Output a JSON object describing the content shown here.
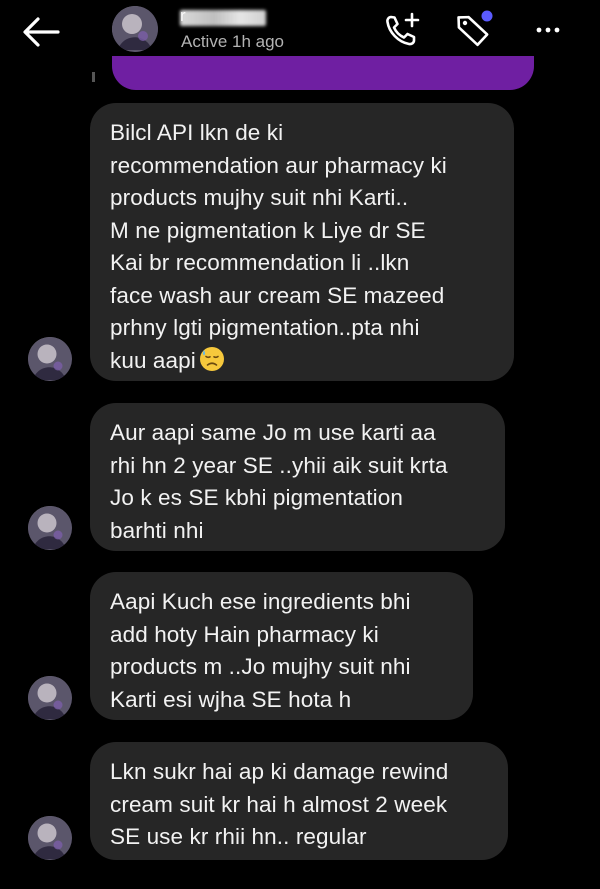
{
  "header": {
    "contact_name": "r",
    "status": "Active 1h ago",
    "icons": {
      "back": "arrow-left-icon",
      "call": "phone-plus-icon",
      "tag": "tag-icon",
      "more": "more-dots-icon"
    },
    "accent_color": "#6f1fa2",
    "tag_badge_color": "#5b5bff"
  },
  "messages": [
    {
      "sender": "contact",
      "text": "Bilcl API lkn de ki\nrecommendation aur pharmacy ki\nproducts mujhy suit nhi Karti..\nM ne pigmentation k Liye dr SE\nKai br recommendation li ..lkn\nface wash aur cream SE mazeed\nprhny lgti pigmentation..pta nhi\nkuu aapi",
      "emoji": "sad-sweat-emoji"
    },
    {
      "sender": "contact",
      "text": "Aur aapi same Jo m use karti aa\nrhi hn 2 year SE ..yhii aik suit krta\nJo k es SE kbhi pigmentation\nbarhti nhi"
    },
    {
      "sender": "contact",
      "text": "Aapi Kuch ese ingredients bhi\nadd hoty Hain pharmacy ki\nproducts m ..Jo mujhy suit nhi\nKarti esi wjha SE hota h"
    },
    {
      "sender": "contact",
      "text": "Lkn sukr hai ap ki damage rewind\ncream suit kr hai h almost 2 week\nSE use kr rhii hn.. regular"
    }
  ]
}
